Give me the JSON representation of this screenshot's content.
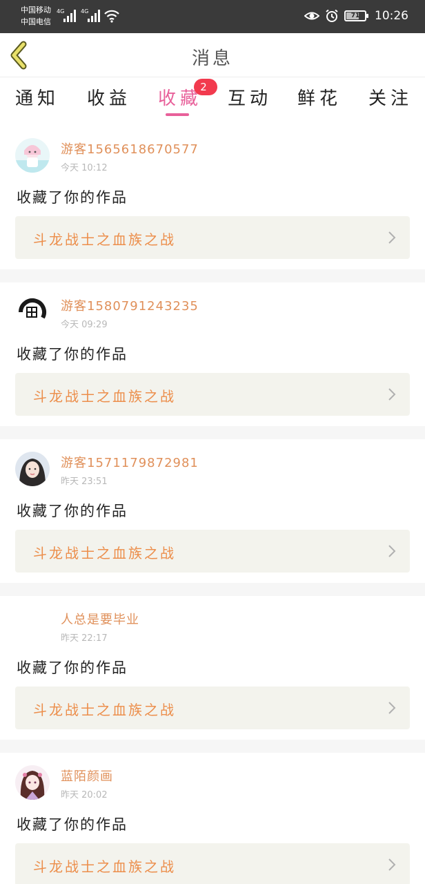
{
  "status_bar": {
    "carrier_1": "中国移动",
    "carrier_2": "中国电信",
    "network_1": "4G",
    "network_2": "4G",
    "battery": "71",
    "time": "10:26",
    "icons": [
      "signal-icon",
      "wifi-icon",
      "eye-icon",
      "alarm-icon",
      "battery-icon"
    ]
  },
  "header": {
    "title": "消息",
    "back_icon": "back-chevron-icon"
  },
  "tabs": [
    {
      "label": "通知"
    },
    {
      "label": "收益"
    },
    {
      "label": "收藏",
      "active": true,
      "badge": "2"
    },
    {
      "label": "互动"
    },
    {
      "label": "鲜花"
    },
    {
      "label": "关注"
    }
  ],
  "colors": {
    "accent": "#e8609a",
    "username": "#e0905a",
    "work_title": "#ec8e4b",
    "badge": "#f23a4e"
  },
  "messages": [
    {
      "user": "游客1565618670577",
      "time": "今天 10:12",
      "text": "收藏了你的作品",
      "work": "斗龙战士之血族之战"
    },
    {
      "user": "游客1580791243235",
      "time": "今天 09:29",
      "text": "收藏了你的作品",
      "work": "斗龙战士之血族之战"
    },
    {
      "user": "游客1571179872981",
      "time": "昨天 23:51",
      "text": "收藏了你的作品",
      "work": "斗龙战士之血族之战"
    },
    {
      "user": "人总是要毕业",
      "time": "昨天 22:17",
      "text": "收藏了你的作品",
      "work": "斗龙战士之血族之战"
    },
    {
      "user": "蓝陌颜画",
      "time": "昨天 20:02",
      "text": "收藏了你的作品",
      "work": "斗龙战士之血族之战"
    }
  ]
}
